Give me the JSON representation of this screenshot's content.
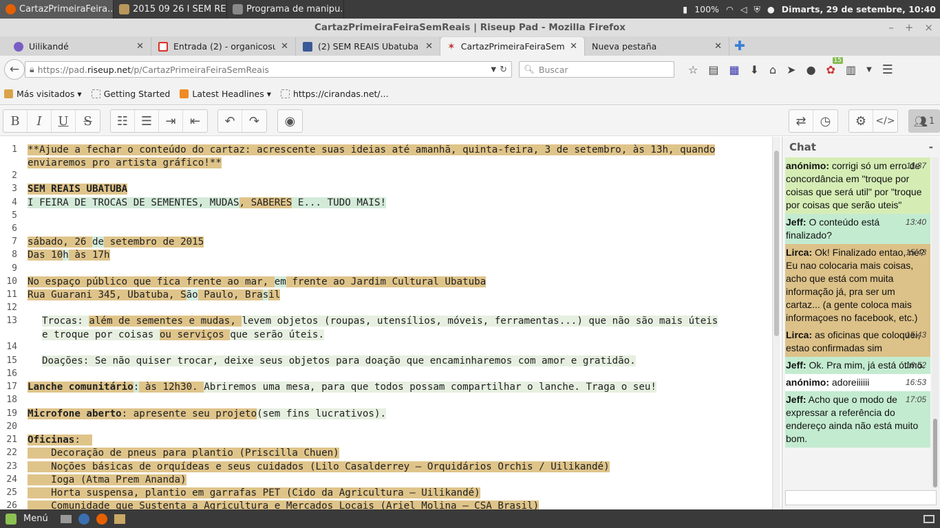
{
  "system_panel": {
    "tasks": [
      {
        "label": "CartazPrimeiraFeira...",
        "color": "#e66000"
      },
      {
        "label": "2015 09 26 I SEM RE...",
        "color": "#b9975b"
      },
      {
        "label": "Programa de manipu...",
        "color": "#888888"
      }
    ],
    "battery": "100%",
    "clock": "Dimarts, 29 de setembre, 10:40"
  },
  "window": {
    "title": "CartazPrimeiraFeiraSemReais | Riseup Pad - Mozilla Firefox",
    "min": "–",
    "max": "+",
    "close": "×"
  },
  "tabs": [
    {
      "label": "Uilikandé",
      "color": "#7a5cc4"
    },
    {
      "label": "Entrada (2) - organicosub...",
      "color": "#d93025"
    },
    {
      "label": "(2) SEM REAIS Ubatuba (...",
      "color": "#3b5998"
    },
    {
      "label": "CartazPrimeiraFeiraSem...",
      "color": "#b33"
    },
    {
      "label": "Nueva pestaña",
      "color": ""
    }
  ],
  "navbar": {
    "url_prefix": "https://pad.",
    "url_host": "riseup.net",
    "url_path": "/p/CartazPrimeiraFeiraSemReais",
    "search_placeholder": "Buscar",
    "badge": "15"
  },
  "bookmarks": [
    {
      "label": "Más visitados ▾"
    },
    {
      "label": "Getting Started"
    },
    {
      "label": "Latest Headlines ▾"
    },
    {
      "label": "https://cirandas.net/..."
    }
  ],
  "editor_toolbar": {
    "bold": "B",
    "italic": "I",
    "underline": "U",
    "strike": "S",
    "user_count": "1"
  },
  "line_numbers": [
    "1",
    "2",
    "3",
    "4",
    "5",
    "6",
    "7",
    "8",
    "9",
    "10",
    "11",
    "12",
    "13",
    "14",
    "15",
    "16",
    "17",
    "18",
    "19",
    "20",
    "21",
    "22",
    "23",
    "24",
    "25",
    "26"
  ],
  "pad": {
    "l1a": "**Ajude a fechar o conteúdo do cartaz: acrescente suas ideias até amanhã, quinta-feira, 3 de setembro, às 13h, quando",
    "l1b": "enviaremos pro artista gráfico!**",
    "l3": "SEM REAIS UBATUBA",
    "l4a": "I FEIRA DE TROCAS DE SEMENTES, MUDAS",
    "l4b": ", SABERES",
    "l4c": " E... TUDO MAIS!",
    "l7a": "sábado, 26 ",
    "l7b": "de",
    "l7c": " setembro de 2015",
    "l8a": "Das 10",
    "l8b": "h",
    "l8c": " às 17h",
    "l10a": "No espaço público que fica frente ao mar, ",
    "l10b": "em",
    "l10c": " frente ao Jardim Cultural Ubatuba",
    "l11a": "Rua Guarani 345, Ubatuba, S",
    "l11b": "ão",
    "l11c": " Paulo, Bra",
    "l11d": "s",
    "l11e": "il",
    "l13a": "Trocas: ",
    "l13b": "além de sementes e mudas, ",
    "l13c": "levem objetos ",
    "l13d": "(roupas, utensílios, móveis, ferramentas...) que não são mais úteis",
    "l14a": "e troque por coisas ",
    "l14b": "ou serviços ",
    "l14c": "que serão úteis.",
    "l15": "Doações: Se não quiser trocar, deixe seus objetos para doação que encaminharemos com amor e gratidão.",
    "l17a": "Lanche comunitário",
    "l17b": ":",
    "l17c": " às 12h30. ",
    "l17d": "Abriremos uma mesa, para que todos possam compartilhar o lanche. Traga o seu!",
    "l19a": "Microfone aberto",
    "l19b": ": apresente seu projeto",
    "l19c": "(sem fins lucrativos).",
    "l21a": "Oficinas",
    "l21b": ":  ",
    "l22": "    Decoração de pneus para plantio (Priscilla Chuen)",
    "l23": "    Noções básicas de orquídeas e seus cuidados (Lilo Casalderrey – Orquidários Orchis / Uilikandé)",
    "l24": "    Ioga (Atma Prem Ananda)",
    "l25": "    Horta suspensa, plantio em garrafas PET (Cido da Agricultura – Uilikandé)",
    "l26": "    Comunidade que Sustenta a Agricultura e Mercados Locais (Ariel Molina – CSA Brasil)"
  },
  "chat": {
    "title": "Chat",
    "collapse": "-",
    "messages": [
      {
        "author": "anónimo:",
        "time": "11:37",
        "text": " corrigi só um erro de concordância em \"troque por coisas que será util\" por \"troque por coisas que serão uteis\"",
        "bg": "#d5edb5"
      },
      {
        "author": "Jeff:",
        "time": "13:40",
        "text": " O conteúdo está finalizado?",
        "bg": "#c3ebd0"
      },
      {
        "author": "Lirca:",
        "time": "15:43",
        "text": " Ok! Finalizado entao, né? Eu nao colocaria mais coisas, acho que está com muita informação já, pra ser um cartaz... (a gente coloca mais informaçoes no facebook, etc.)",
        "bg": "#dcc188"
      },
      {
        "author": "Lirca:",
        "time": "15:43",
        "text": " as oficinas que coloquei, estao confirmadas sim",
        "bg": "#dcc188"
      },
      {
        "author": "Jeff:",
        "time": "16:52",
        "text": " Ok. Pra mim, já está ótimo.",
        "bg": "#c3ebd0"
      },
      {
        "author": "anónimo:",
        "time": "16:53",
        "text": " adoreiiiiii",
        "bg": "#ffffff"
      },
      {
        "author": "Jeff:",
        "time": "17:05",
        "text": " Acho que o modo de expressar a referência do endereço ainda não está muito bom.",
        "bg": "#c3ebd0"
      }
    ]
  },
  "bottom_panel": {
    "menu": "Menú"
  }
}
